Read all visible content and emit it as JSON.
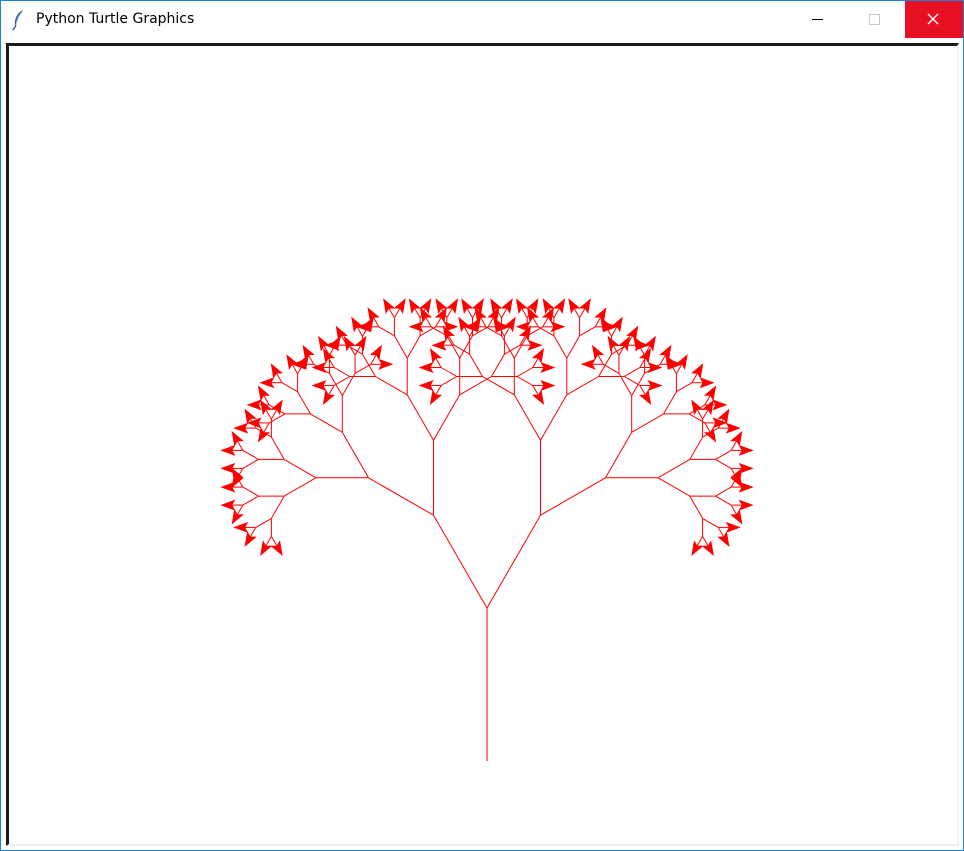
{
  "window": {
    "title": "Python Turtle Graphics",
    "icon": "feather-icon",
    "controls": {
      "minimize": "minimize-icon",
      "maximize": "maximize-icon",
      "close": "close-icon"
    },
    "accent_color": "#1883d7",
    "close_color": "#e81123"
  },
  "canvas": {
    "background": "#ffffff",
    "drawing": {
      "type": "recursive fractal tree",
      "pen_color": "#ff0000",
      "turtle_shape": "arrow",
      "depth": 7,
      "branch_angle_deg": 30,
      "length_ratio": 0.7
    }
  }
}
